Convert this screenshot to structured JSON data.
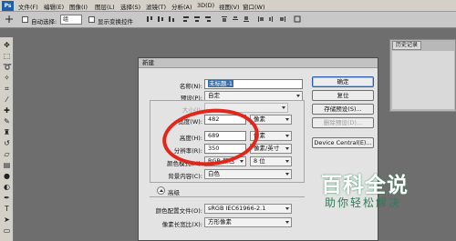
{
  "menubar": {
    "logo": "Ps",
    "items": [
      "文件(F)",
      "编辑(E)",
      "图像(I)",
      "图层(L)",
      "选择(S)",
      "滤镜(T)",
      "分析(A)",
      "3D(D)",
      "视图(V)",
      "窗口(W)"
    ]
  },
  "options_bar": {
    "auto_select_label": "自动选择:",
    "auto_select_value": "组",
    "show_transform_label": "显示变换控件"
  },
  "right_panel": {
    "tab": "历史记录"
  },
  "dialog": {
    "title": "新建",
    "name_label": "名称(N):",
    "name_value": "未标题-1",
    "preset_label": "预设(P):",
    "preset_value": "自定",
    "size_label": "大小(I):",
    "width_label": "宽度(W):",
    "width_value": "482",
    "width_unit": "像素",
    "height_label": "高度(H):",
    "height_value": "689",
    "height_unit": "像素",
    "resolution_label": "分辨率(R):",
    "resolution_value": "350",
    "resolution_unit": "像素/英寸",
    "color_mode_label": "颜色模式(M):",
    "color_mode_value": "RGB 颜色",
    "bit_depth_value": "8 位",
    "background_label": "背景内容(C):",
    "background_value": "白色",
    "advanced_label": "高级",
    "profile_label": "颜色配置文件(O):",
    "profile_value": "sRGB IEC61966-2.1",
    "aspect_label": "像素长宽比(X):",
    "aspect_value": "方形像素",
    "buttons": {
      "ok": "确定",
      "reset": "复位",
      "save_preset": "存储预设(S)...",
      "delete_preset": "删除预设(D)...",
      "device_central": "Device Central(E)..."
    }
  },
  "watermark": {
    "main": "百科全说",
    "sub": "助你轻松解决"
  },
  "colors": {
    "highlight": "#e3261b",
    "selection": "#3a6ea5",
    "workspace": "#6e6e6e"
  }
}
